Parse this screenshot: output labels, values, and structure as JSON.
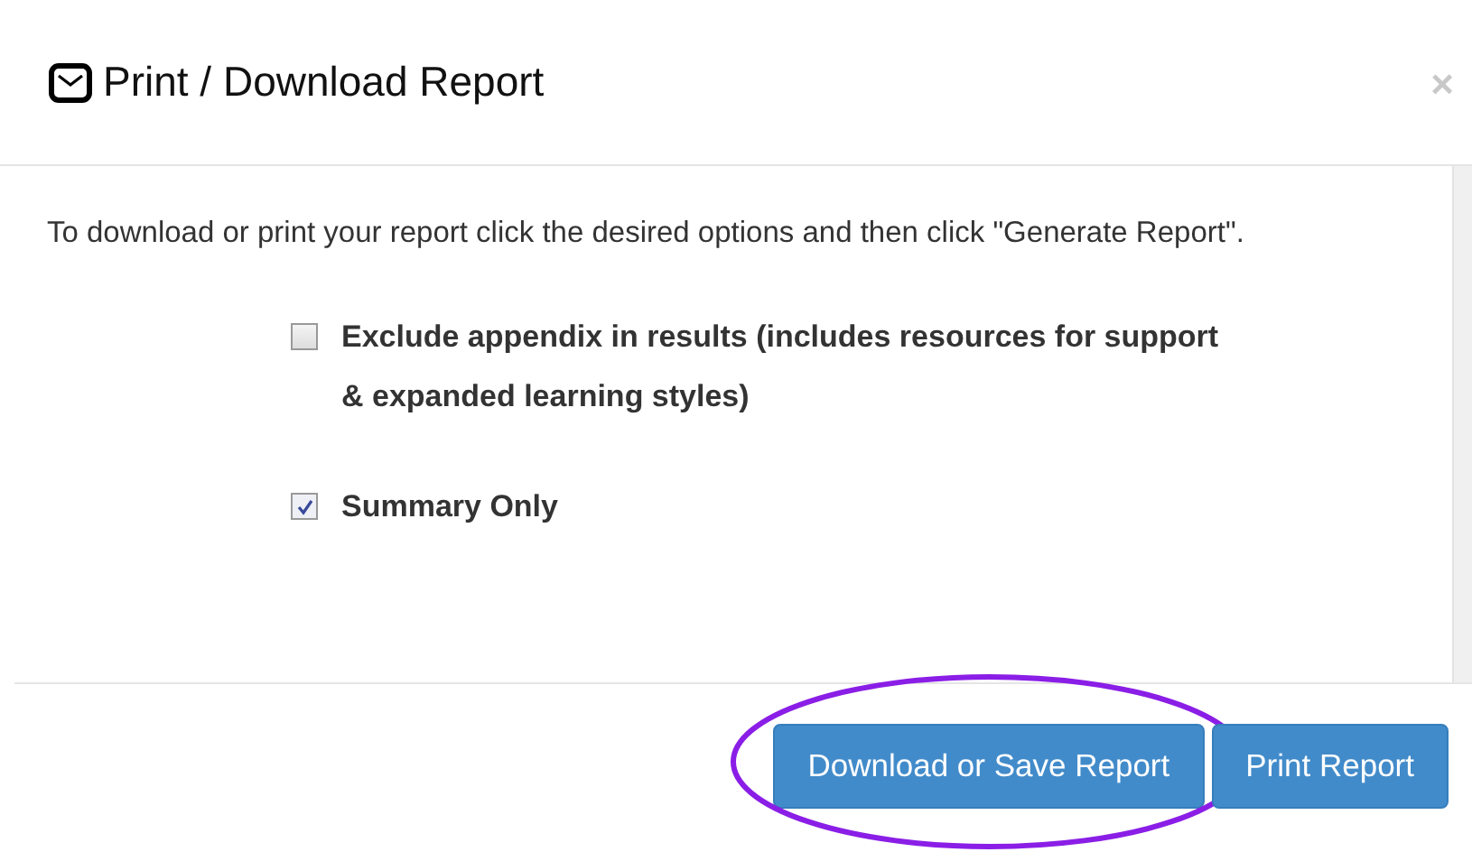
{
  "dialog": {
    "title": "Print / Download Report",
    "close": "×"
  },
  "body": {
    "instructions": "To download or print your report click the desired options and then click \"Generate Report\".",
    "options": [
      {
        "label": "Exclude appendix in results (includes resources for support & expanded learning styles)",
        "checked": false
      },
      {
        "label": "Summary Only",
        "checked": true
      }
    ]
  },
  "footer": {
    "buttons": [
      {
        "label": "Download or Save Report",
        "kind": "circled"
      },
      {
        "label": "Print Report",
        "kind": "plain"
      }
    ]
  }
}
